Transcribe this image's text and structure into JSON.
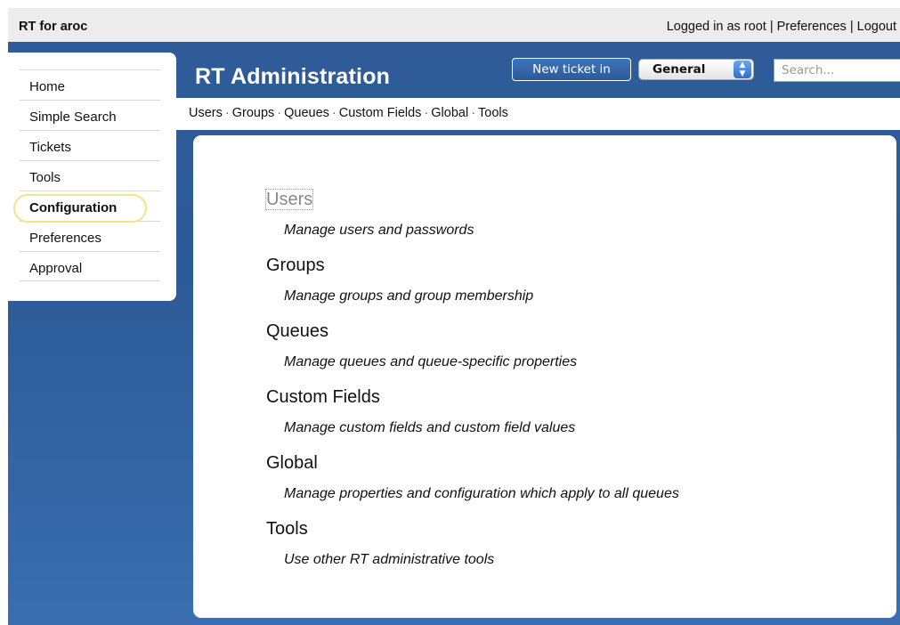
{
  "topbar": {
    "app_title": "RT for aroc",
    "logged_in": "Logged in as root",
    "separator": " | ",
    "preferences": "Preferences",
    "logout": "Logout"
  },
  "sidebar": {
    "items": [
      {
        "label": "Home"
      },
      {
        "label": "Simple Search"
      },
      {
        "label": "Tickets"
      },
      {
        "label": "Tools"
      },
      {
        "label": "Configuration",
        "active": true
      },
      {
        "label": "Preferences"
      },
      {
        "label": "Approval"
      }
    ]
  },
  "header": {
    "title": "RT Administration",
    "new_ticket_label": "New ticket in",
    "queue_selected": "General",
    "search_placeholder": "Search..."
  },
  "subnav": {
    "items": [
      "Users",
      "Groups",
      "Queues",
      "Custom Fields",
      "Global",
      "Tools"
    ],
    "separator": "·"
  },
  "main": {
    "sections": [
      {
        "title": "Users",
        "description": "Manage users and passwords"
      },
      {
        "title": "Groups",
        "description": "Manage groups and group membership"
      },
      {
        "title": "Queues",
        "description": "Manage queues and queue-specific properties"
      },
      {
        "title": "Custom Fields",
        "description": "Manage custom fields and custom field values"
      },
      {
        "title": "Global",
        "description": "Manage properties and configuration which apply to all queues"
      },
      {
        "title": "Tools",
        "description": "Use other RT administrative tools"
      }
    ]
  },
  "colors": {
    "header_blue": "#2f5c99",
    "highlight_ring": "#efe58a",
    "topbar_gray": "#ececec"
  }
}
